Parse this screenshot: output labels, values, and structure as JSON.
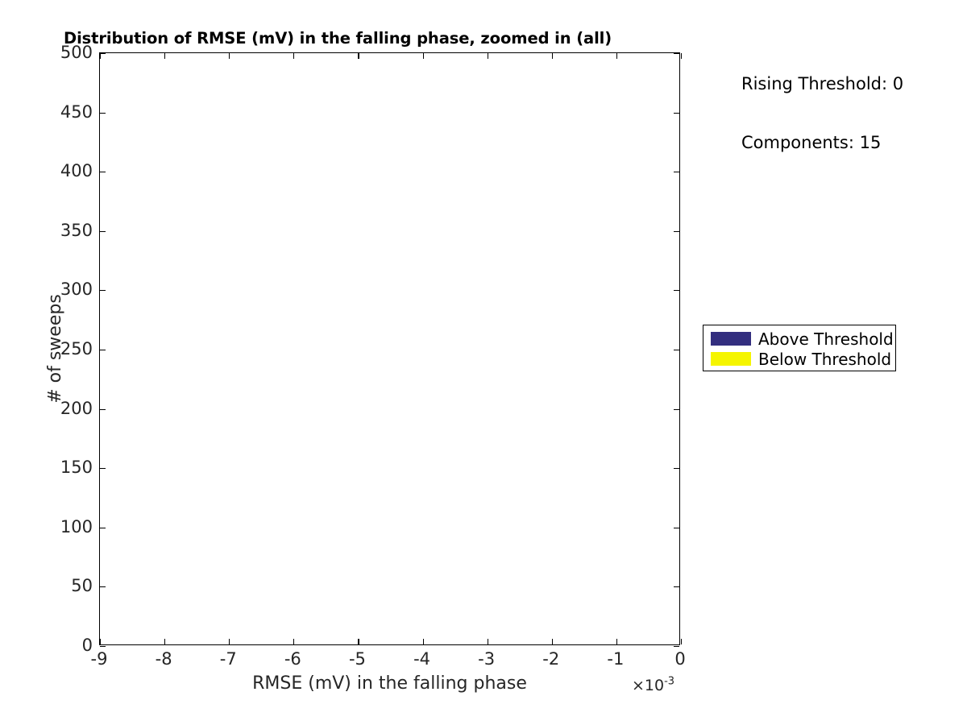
{
  "chart_data": {
    "type": "bar",
    "title": "Distribution of RMSE (mV) in the falling phase, zoomed in (all)",
    "subtitle": "",
    "xlabel": "RMSE (mV) in the falling phase",
    "ylabel": "# of sweeps",
    "x_exponent_prefix": "×10",
    "x_exponent_power": "-3",
    "x_exponent_full": "×10-3",
    "xlim": [
      -9,
      0
    ],
    "ylim": [
      0,
      500
    ],
    "x_tick_labels": [
      "-9",
      "-8",
      "-7",
      "-6",
      "-5",
      "-4",
      "-3",
      "-2",
      "-1",
      "0"
    ],
    "x_tick_values": [
      -9,
      -8,
      -7,
      -6,
      -5,
      -4,
      -3,
      -2,
      -1,
      0
    ],
    "y_tick_labels": [
      "0",
      "50",
      "100",
      "150",
      "200",
      "250",
      "300",
      "350",
      "400",
      "450",
      "500"
    ],
    "y_tick_values": [
      0,
      50,
      100,
      150,
      200,
      250,
      300,
      350,
      400,
      450,
      500
    ],
    "grid": false,
    "legend_position": "outside-right",
    "series": [
      {
        "name": "Above Threshold",
        "color": "#332E7F",
        "values": []
      },
      {
        "name": "Below Threshold",
        "color": "#F5F500",
        "values": []
      }
    ],
    "categories": [],
    "data_present": false,
    "annotations": [
      "Rising Threshold: 0",
      "Components: 15"
    ]
  },
  "title": {
    "text": "Distribution of RMSE (mV) in the falling phase, zoomed in (all)"
  },
  "axes": {
    "x_label": "RMSE (mV) in the falling phase",
    "y_label": "# of sweeps",
    "x_ticks": [
      "-9",
      "-8",
      "-7",
      "-6",
      "-5",
      "-4",
      "-3",
      "-2",
      "-1",
      "0"
    ],
    "y_ticks": [
      "500",
      "450",
      "400",
      "350",
      "300",
      "250",
      "200",
      "150",
      "100",
      "50",
      "0"
    ],
    "x_exponent_prefix": "×10",
    "x_exponent_power": "-3"
  },
  "annotations": {
    "rising_threshold": "Rising Threshold: 0",
    "components": "Components: 15"
  },
  "legend": {
    "entries": [
      {
        "label": "Above Threshold",
        "color": "#332E7F"
      },
      {
        "label": "Below Threshold",
        "color": "#F5F500"
      }
    ]
  }
}
